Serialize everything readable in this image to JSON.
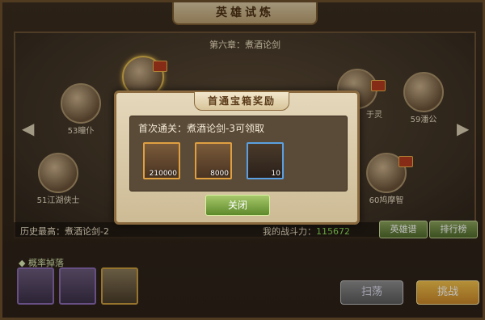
{
  "header": {
    "title": "英雄试炼"
  },
  "map": {
    "chapter": "第六章：煮酒论剑",
    "nodes": [
      {
        "label": "53瞳仆"
      },
      {
        "label": "51江湖侠士"
      },
      {
        "label": "于灵"
      },
      {
        "label": "59潘公"
      },
      {
        "label": "60鸠摩智"
      }
    ]
  },
  "status": {
    "history_label": "历史最高：煮酒论剑-2",
    "power_label": "我的战斗力：",
    "power_value": "115672"
  },
  "buttons": {
    "hero_book": "英雄谱",
    "ranking": "排行榜",
    "sweep": "扫荡",
    "challenge": "挑战"
  },
  "drops": {
    "title": "概率掉落"
  },
  "modal": {
    "title": "首通宝箱奖励",
    "first_clear": "首次通关：煮酒论剑-3可领取",
    "rewards": [
      {
        "icon": "gold-ticket-icon",
        "count": "210000"
      },
      {
        "icon": "silver-ingot-icon",
        "count": "8000"
      },
      {
        "icon": "hero-portrait-icon",
        "count": "10"
      }
    ],
    "close": "关闭"
  },
  "colors": {
    "accent": "#e0b84c",
    "power": "#8ee05a",
    "button_green": "#5e8a2c"
  }
}
